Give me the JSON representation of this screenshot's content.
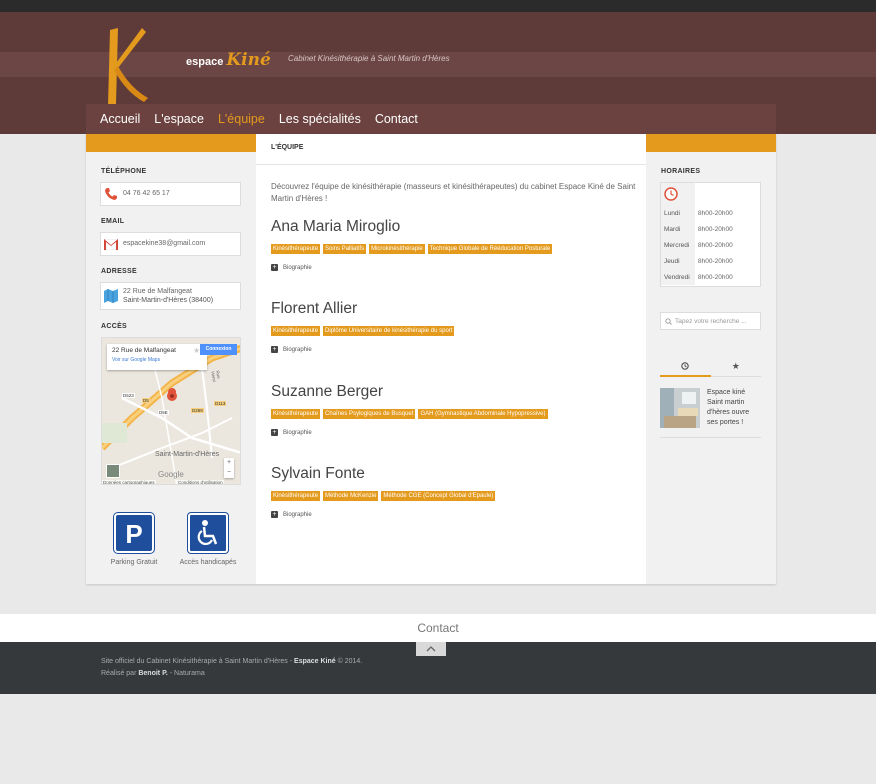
{
  "header": {
    "logo_word": "espace",
    "logo_brand": "Kiné",
    "tagline": "Cabinet Kinésithérapie à Saint Martin d'Hères"
  },
  "nav": [
    "Accueil",
    "L'espace",
    "L'équipe",
    "Les spécialités",
    "Contact"
  ],
  "left": {
    "phone_label": "TÉLÉPHONE",
    "phone": "04 76 42 65 17",
    "email_label": "EMAIL",
    "email": "espacekine38@gmail.com",
    "address_label": "ADRESSE",
    "address_line1": "22 Rue de Malfangeat",
    "address_line2": "Saint-Martin-d'Hères (38400)",
    "access_label": "ACCÈS",
    "map": {
      "place": "22 Rue de Malfangeat",
      "view_link": "Voir sur Google Maps",
      "login": "Connexion",
      "city": "Saint-Martin-d'Hères",
      "credit1": "Données cartographiques",
      "credit2": "Conditions d'utilisation",
      "brand": "Google",
      "roads": [
        "D269",
        "D523",
        "D113",
        "D5",
        "D5E",
        "Rue Henri"
      ]
    },
    "parking_label": "Parking Gratuit",
    "handicap_label": "Accès handicapés"
  },
  "main": {
    "heading": "L'ÉQUIPE",
    "intro": "Découvrez l'équipe de kinésithérapie (masseurs et kinésithérapeutes) du cabinet Espace Kiné de Saint Martin d'Hères !",
    "bio_label": "Biographie",
    "people": [
      {
        "name": "Ana Maria Miroglio",
        "tags": [
          "Kinésithérapeute",
          "Soins Palliatifs",
          "Microkinésithérapie",
          "Technique Globale de Rééducation Posturale"
        ]
      },
      {
        "name": "Florent Allier",
        "tags": [
          "Kinésithérapeute",
          "Diplôme Universitaire de kinésithérapie du sport"
        ]
      },
      {
        "name": "Suzanne Berger",
        "tags": [
          "Kinésithérapeute",
          "Chaînes Psylogiques de Busquet",
          "GAH (Gymnastique Abdominale Hypopressive)"
        ]
      },
      {
        "name": "Sylvain Fonte",
        "tags": [
          "Kinésithérapeute",
          "Méthode McKenzie",
          "Méthode CGE (Concept Global d'Epaule)"
        ]
      }
    ]
  },
  "right": {
    "hours_label": "HORAIRES",
    "hours": [
      {
        "day": "Lundi",
        "time": "8h00-20h00"
      },
      {
        "day": "Mardi",
        "time": "8h00-20h00"
      },
      {
        "day": "Mercredi",
        "time": "8h00-20h00"
      },
      {
        "day": "Jeudi",
        "time": "8h00-20h00"
      },
      {
        "day": "Vendredi",
        "time": "8h00-20h00"
      }
    ],
    "search_placeholder": "Tapez votre recherche ...",
    "post": "Espace kiné Saint martin d'hères ouvre ses portes !"
  },
  "footer": {
    "contact": "Contact",
    "line1_pre": "Site officiel du Cabinet Kinésithérapie à Saint Martin d'Hères - ",
    "line1_bold": "Espace Kiné",
    "line1_post": " © 2014.",
    "line2_pre": "Réalisé par ",
    "line2_bold": "Benoit P.",
    "line2_post": " - Naturama"
  },
  "colors": {
    "accent": "#e39a1d",
    "header": "#5e3a38",
    "nav": "#6b4240",
    "footer": "#35393c"
  }
}
